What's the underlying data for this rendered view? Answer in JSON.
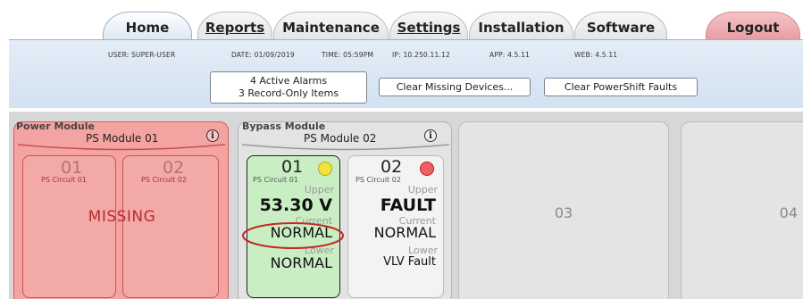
{
  "tabs": {
    "home": "Home",
    "reports": "Reports",
    "maintenance": "Maintenance",
    "settings": "Settings",
    "installation": "Installation",
    "software": "Software",
    "logout": "Logout"
  },
  "status": {
    "user": "USER: SUPER-USER",
    "date": "DATE: 01/09/2019",
    "time": "TIME: 05:59PM",
    "ip": "IP: 10.250.11.12",
    "app": "APP: 4.5.11",
    "web": "WEB: 4.5.11"
  },
  "alarms": {
    "active": "4 Active Alarms",
    "record_only": "3 Record-Only Items"
  },
  "buttons": {
    "clear_missing": "Clear Missing Devices...",
    "clear_faults": "Clear PowerShift Faults"
  },
  "colors": {
    "missing_red": "#f4a3a3",
    "normal_green": "#c9eec4",
    "dot_yellow": "#f2e43a",
    "dot_red": "#f06060",
    "highlight_ellipse": "#c62828"
  },
  "power_module": {
    "title": "Power Module",
    "name": "PS Module 01",
    "info_icon": "i",
    "status": "MISSING",
    "circuits": [
      {
        "num": "01",
        "label": "PS Circuit 01"
      },
      {
        "num": "02",
        "label": "PS Circuit 02"
      }
    ]
  },
  "bypass_module": {
    "title": "Bypass Module",
    "name": "PS Module 02",
    "info_icon": "i",
    "circuits": [
      {
        "num": "01",
        "label": "PS Circuit 01",
        "upper_label": "Upper",
        "upper_value": "53.30 V",
        "current_label": "Current",
        "current_value": "NORMAL",
        "lower_label": "Lower",
        "lower_value": "NORMAL",
        "indicator": "yellow"
      },
      {
        "num": "02",
        "label": "PS Circuit 02",
        "upper_label": "Upper",
        "upper_value": "FAULT",
        "current_label": "Current",
        "current_value": "NORMAL",
        "lower_label": "Lower",
        "lower_value": "VLV Fault",
        "indicator": "red"
      }
    ]
  },
  "empty_slots": [
    "03",
    "04"
  ]
}
